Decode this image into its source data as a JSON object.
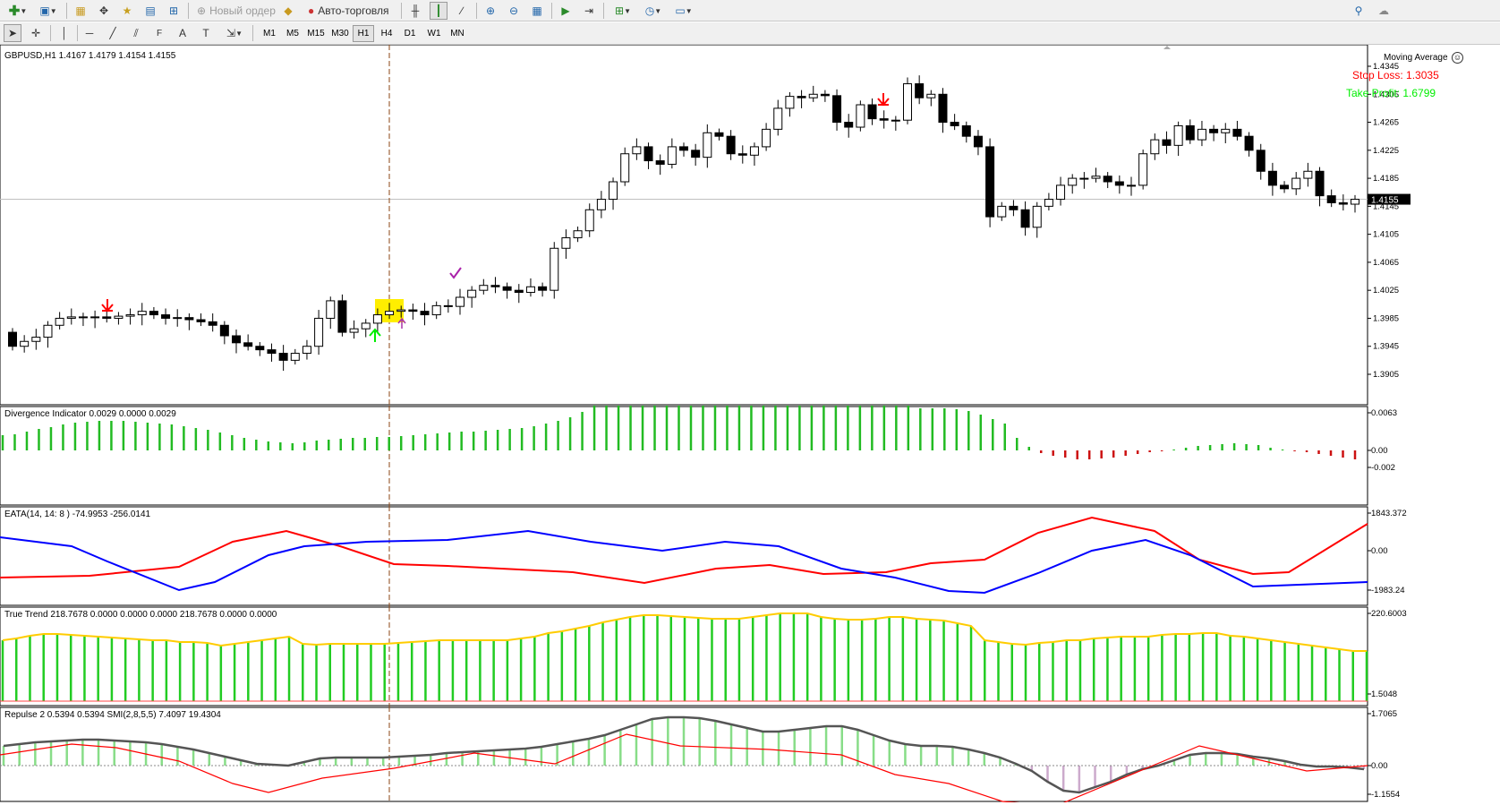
{
  "toolbar": {
    "new_order_label": "Новый ордер",
    "autotrading_label": "Авто-торговля",
    "timeframes": [
      "M1",
      "M5",
      "M15",
      "M30",
      "H1",
      "H4",
      "D1",
      "W1",
      "MN"
    ],
    "active_timeframe": "H1",
    "icons": [
      "new-chart-icon",
      "profiles-icon",
      "market-watch-icon",
      "navigator-icon",
      "favorites-icon",
      "data-window-icon",
      "strategy-tester-icon",
      "new-order-icon",
      "metaeditor-icon",
      "autotrading-icon",
      "bar-chart-icon",
      "candlestick-icon",
      "line-chart-icon",
      "zoom-in-icon",
      "zoom-out-icon",
      "tile-windows-icon",
      "autoscroll-icon",
      "chart-shift-icon",
      "indicators-icon",
      "periods-icon",
      "templates-icon",
      "search-icon",
      "community-icon",
      "cursor-icon",
      "crosshair-icon",
      "vertical-line-icon",
      "horizontal-line-icon",
      "trendline-icon",
      "equidistant-channel-icon",
      "fibonacci-icon",
      "text-icon",
      "text-label-icon",
      "arrows-icon"
    ]
  },
  "main_chart": {
    "header": "GBPUSD,H1  1.4167 1.4179 1.4154 1.4155",
    "ea_name": "Moving Average",
    "stop_loss": "Stop Loss: 1.3035",
    "take_profit": "Take Profit: 1.6799",
    "current_price": "1.4155",
    "price_ticks": [
      "1.4345",
      "1.4305",
      "1.4265",
      "1.4225",
      "1.4185",
      "1.4145",
      "1.4105",
      "1.4065",
      "1.4025",
      "1.3985",
      "1.3945",
      "1.3905"
    ],
    "colors": {
      "stop_loss": "#ff0000",
      "take_profit": "#00ff00",
      "bull": "#ffffff",
      "bear": "#000000",
      "price_line": "#c0c0c0"
    }
  },
  "divergence": {
    "header": "Divergence Indicator 0.0029 0.0000 0.0029",
    "ticks": [
      "0.0063",
      "0.00",
      "-0.002"
    ],
    "colors": {
      "up": "#22bb22",
      "down": "#cc1111"
    }
  },
  "eata": {
    "header": "EATA(14, 14: 8 ) -74.9953 -256.0141",
    "ticks": [
      "1843.372",
      "0.00",
      "-1983.24"
    ],
    "colors": {
      "red": "#ff0000",
      "blue": "#0000ff"
    }
  },
  "true_trend": {
    "header": "True Trend 218.7678 0.0000 0.0000 0.0000 218.7678 0.0000 0.0000",
    "ticks": [
      "220.6003",
      "1.5048"
    ],
    "colors": {
      "bars": "#22cc22",
      "line": "#ffcc00"
    }
  },
  "repulse": {
    "header": "Repulse 2 0.5394 0.5394  SMI(2,8,5,5) 7.4097 19.4304",
    "ticks": [
      "1.7065",
      "0.00",
      "-1.1554"
    ],
    "colors": {
      "pos": "#88dd88",
      "neg": "#ccaacc",
      "smi": "#555555",
      "signal": "#ff0000"
    }
  }
}
